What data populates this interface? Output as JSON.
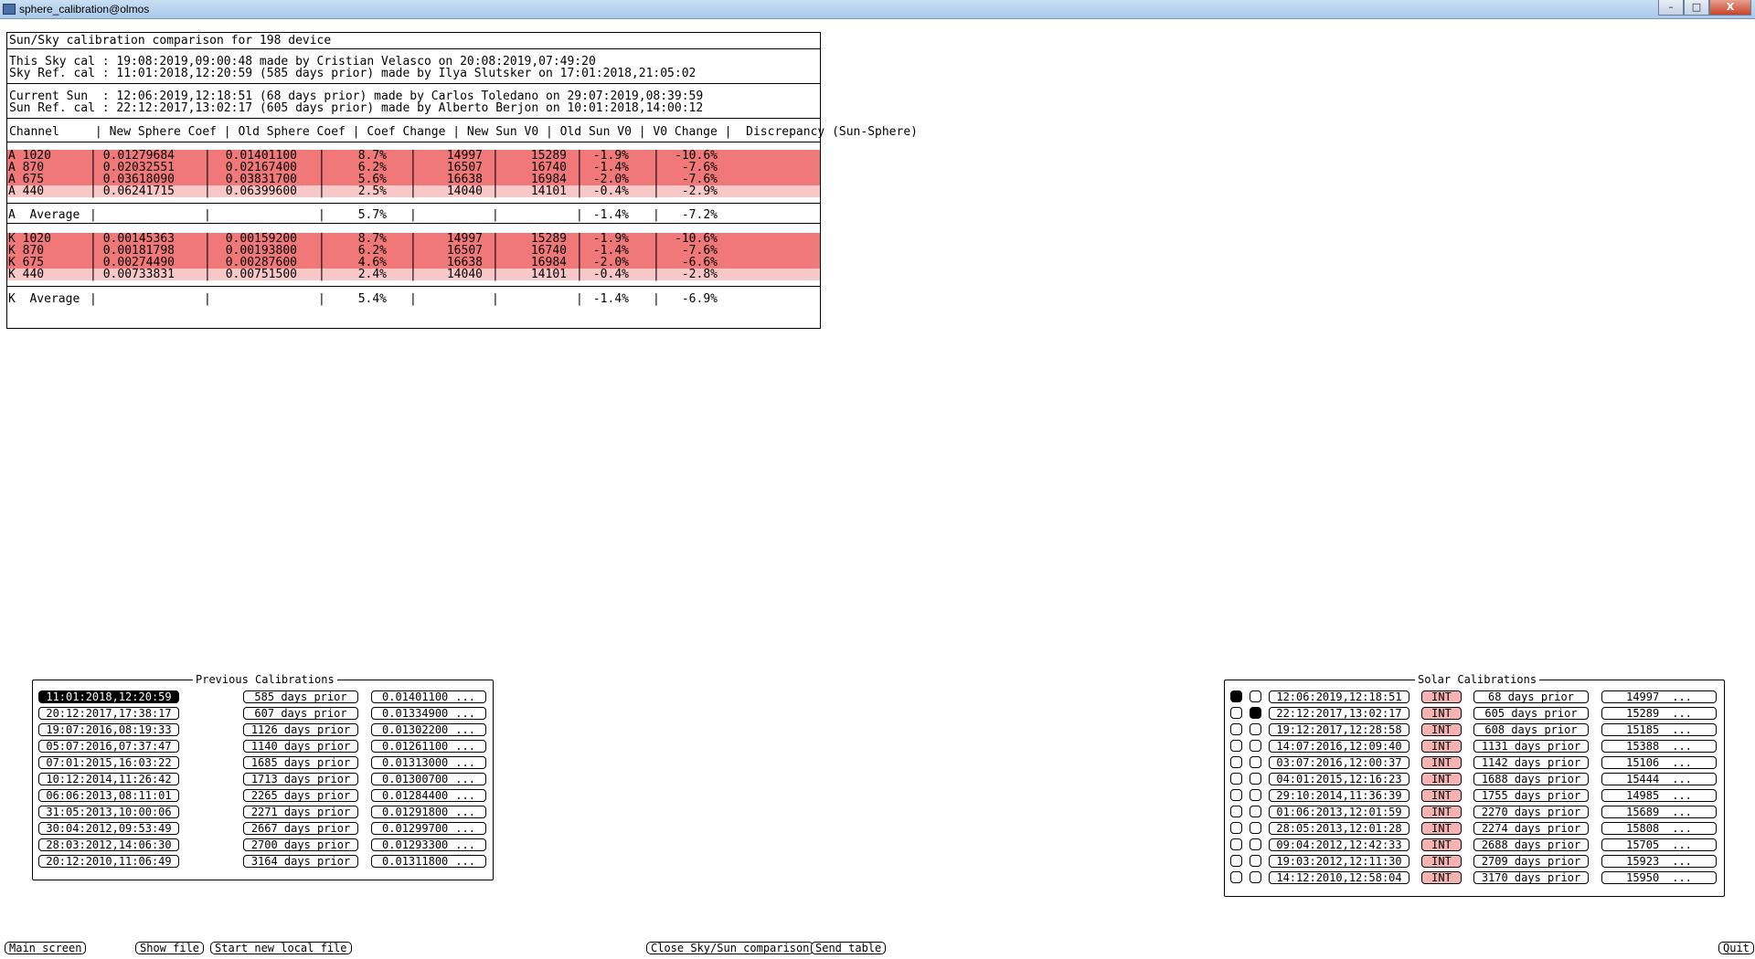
{
  "window": {
    "title": "sphere_calibration@olmos",
    "buttons": [
      "–",
      "□",
      "X"
    ]
  },
  "comparison": {
    "title": "Sun/Sky calibration comparison for 198 device",
    "sky_line1": "This Sky cal : 19:08:2019,09:00:48 made by Cristian Velasco on 20:08:2019,07:49:20",
    "sky_line2": "Sky Ref. cal : 11:01:2018,12:20:59 (585 days prior) made by Ilya Slutsker on 17:01:2018,21:05:02",
    "sun_line1": "Current Sun  : 12:06:2019,12:18:51 (68 days prior) made by Carlos Toledano on 29:07:2019,08:39:59",
    "sun_line2": "Sun Ref. cal : 22:12:2017,13:02:17 (605 days prior) made by Alberto Berjon on 10:01:2018,14:00:12",
    "headers": [
      "Channel",
      "New Sphere Coef",
      "Old Sphere Coef",
      "Coef Change",
      "New Sun V0",
      "Old Sun V0",
      "V0 Change",
      "Discrepancy (Sun-Sphere)"
    ],
    "header_line": "Channel     | New Sphere Coef | Old Sphere Coef | Coef Change | New Sun V0 | Old Sun V0 | V0 Change |  Discrepancy (Sun-Sphere)",
    "groupA": [
      {
        "ch": "A 1020",
        "new": "0.01279684",
        "old": "0.01401100",
        "coef": "8.7%",
        "nsun": "14997",
        "osun": "15289",
        "v0": "-1.9%",
        "disc": "-10.6%",
        "hl": "red"
      },
      {
        "ch": "A 870",
        "new": "0.02032551",
        "old": "0.02167400",
        "coef": "6.2%",
        "nsun": "16507",
        "osun": "16740",
        "v0": "-1.4%",
        "disc": "-7.6%",
        "hl": "red"
      },
      {
        "ch": "A 675",
        "new": "0.03618090",
        "old": "0.03831700",
        "coef": "5.6%",
        "nsun": "16638",
        "osun": "16984",
        "v0": "-2.0%",
        "disc": "-7.6%",
        "hl": "red"
      },
      {
        "ch": "A 440",
        "new": "0.06241715",
        "old": "0.06399600",
        "coef": "2.5%",
        "nsun": "14040",
        "osun": "14101",
        "v0": "-0.4%",
        "disc": "-2.9%",
        "hl": "pink"
      }
    ],
    "avgA": {
      "ch": "A  Average",
      "coef": "5.7%",
      "v0": "-1.4%",
      "disc": "-7.2%"
    },
    "groupK": [
      {
        "ch": "K 1020",
        "new": "0.00145363",
        "old": "0.00159200",
        "coef": "8.7%",
        "nsun": "14997",
        "osun": "15289",
        "v0": "-1.9%",
        "disc": "-10.6%",
        "hl": "red"
      },
      {
        "ch": "K 870",
        "new": "0.00181798",
        "old": "0.00193800",
        "coef": "6.2%",
        "nsun": "16507",
        "osun": "16740",
        "v0": "-1.4%",
        "disc": "-7.6%",
        "hl": "red"
      },
      {
        "ch": "K 675",
        "new": "0.00274490",
        "old": "0.00287600",
        "coef": "4.6%",
        "nsun": "16638",
        "osun": "16984",
        "v0": "-2.0%",
        "disc": "-6.6%",
        "hl": "red"
      },
      {
        "ch": "K 440",
        "new": "0.00733831",
        "old": "0.00751500",
        "coef": "2.4%",
        "nsun": "14040",
        "osun": "14101",
        "v0": "-0.4%",
        "disc": "-2.8%",
        "hl": "pink"
      }
    ],
    "avgK": {
      "ch": "K  Average",
      "coef": "5.4%",
      "v0": "-1.4%",
      "disc": "-6.9%"
    }
  },
  "previous": {
    "title": "Previous Calibrations",
    "items": [
      {
        "date": "11:01:2018,12:20:59",
        "days": "585 days prior",
        "coef": "0.01401100",
        "more": "...",
        "selected": true
      },
      {
        "date": "20:12:2017,17:38:17",
        "days": "607 days prior",
        "coef": "0.01334900",
        "more": "..."
      },
      {
        "date": "19:07:2016,08:19:33",
        "days": "1126 days prior",
        "coef": "0.01302200",
        "more": "..."
      },
      {
        "date": "05:07:2016,07:37:47",
        "days": "1140 days prior",
        "coef": "0.01261100",
        "more": "..."
      },
      {
        "date": "07:01:2015,16:03:22",
        "days": "1685 days prior",
        "coef": "0.01313000",
        "more": "..."
      },
      {
        "date": "10:12:2014,11:26:42",
        "days": "1713 days prior",
        "coef": "0.01300700",
        "more": "..."
      },
      {
        "date": "06:06:2013,08:11:01",
        "days": "2265 days prior",
        "coef": "0.01284400",
        "more": "..."
      },
      {
        "date": "31:05:2013,10:00:06",
        "days": "2271 days prior",
        "coef": "0.01291800",
        "more": "..."
      },
      {
        "date": "30:04:2012,09:53:49",
        "days": "2667 days prior",
        "coef": "0.01299700",
        "more": "..."
      },
      {
        "date": "28:03:2012,14:06:30",
        "days": "2700 days prior",
        "coef": "0.01293300",
        "more": "..."
      },
      {
        "date": "20:12:2010,11:06:49",
        "days": "3164 days prior",
        "coef": "0.01311800",
        "more": "..."
      }
    ]
  },
  "solar": {
    "title": "Solar Calibrations",
    "items": [
      {
        "date": "12:06:2019,12:18:51",
        "type": "INT",
        "days": "68 days prior",
        "v0": "14997",
        "more": "...",
        "r1": true,
        "r2": false
      },
      {
        "date": "22:12:2017,13:02:17",
        "type": "INT",
        "days": "605 days prior",
        "v0": "15289",
        "more": "...",
        "r1": false,
        "r2": true
      },
      {
        "date": "19:12:2017,12:28:58",
        "type": "INT",
        "days": "608 days prior",
        "v0": "15185",
        "more": "..."
      },
      {
        "date": "14:07:2016,12:09:40",
        "type": "INT",
        "days": "1131 days prior",
        "v0": "15388",
        "more": "..."
      },
      {
        "date": "03:07:2016,12:00:37",
        "type": "INT",
        "days": "1142 days prior",
        "v0": "15106",
        "more": "..."
      },
      {
        "date": "04:01:2015,12:16:23",
        "type": "INT",
        "days": "1688 days prior",
        "v0": "15444",
        "more": "..."
      },
      {
        "date": "29:10:2014,11:36:39",
        "type": "INT",
        "days": "1755 days prior",
        "v0": "14985",
        "more": "..."
      },
      {
        "date": "01:06:2013,12:01:59",
        "type": "INT",
        "days": "2270 days prior",
        "v0": "15689",
        "more": "..."
      },
      {
        "date": "28:05:2013,12:01:28",
        "type": "INT",
        "days": "2274 days prior",
        "v0": "15808",
        "more": "..."
      },
      {
        "date": "09:04:2012,12:42:33",
        "type": "INT",
        "days": "2688 days prior",
        "v0": "15705",
        "more": "..."
      },
      {
        "date": "19:03:2012,12:11:30",
        "type": "INT",
        "days": "2709 days prior",
        "v0": "15923",
        "more": "..."
      },
      {
        "date": "14:12:2010,12:58:04",
        "type": "INT",
        "days": "3170 days prior",
        "v0": "15950",
        "more": "..."
      }
    ]
  },
  "bottom": {
    "main_screen": "Main screen",
    "show_file": "Show file",
    "start_local": "Start new local file",
    "close_cmp": "Close Sky/Sun comparison",
    "send_table": "Send table",
    "quit": "Quit"
  },
  "colors": {
    "red": "#f07878",
    "pink": "#f8c8c8",
    "int": "#f4b2b2"
  }
}
